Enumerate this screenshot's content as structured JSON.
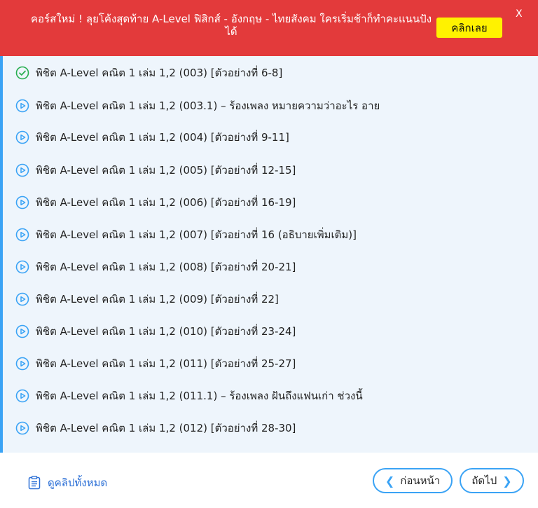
{
  "banner": {
    "text": "คอร์สใหม่ ! ลุยโค้งสุดท้าย A-Level ฟิสิกส์ - อังกฤษ - ไทยสังคม ใครเริ่มช้าก็ทำคะแนนปังได้",
    "cta_label": "คลิกเลย",
    "close_label": "X",
    "bg_color": "#e33a3b",
    "cta_color": "#fff200"
  },
  "lessons": [
    {
      "icon": "check-circle-icon",
      "title": "พิชิต A-Level คณิต 1 เล่ม 1,2 (003) [ตัวอย่างที่ 6-8]"
    },
    {
      "icon": "play-circle-icon",
      "title": "พิชิต A-Level คณิต 1 เล่ม 1,2 (003.1) – ร้องเพลง หมายความว่าอะไร อาย"
    },
    {
      "icon": "play-circle-icon",
      "title": "พิชิต A-Level คณิต 1 เล่ม 1,2 (004) [ตัวอย่างที่ 9-11]"
    },
    {
      "icon": "play-circle-icon",
      "title": "พิชิต A-Level คณิต 1 เล่ม 1,2 (005) [ตัวอย่างที่ 12-15]"
    },
    {
      "icon": "play-circle-icon",
      "title": "พิชิต A-Level คณิต 1 เล่ม 1,2 (006) [ตัวอย่างที่ 16-19]"
    },
    {
      "icon": "play-circle-icon",
      "title": "พิชิต A-Level คณิต 1 เล่ม 1,2 (007) [ตัวอย่างที่ 16 (อธิบายเพิ่มเติม)]"
    },
    {
      "icon": "play-circle-icon",
      "title": "พิชิต A-Level คณิต 1 เล่ม 1,2 (008) [ตัวอย่างที่ 20-21]"
    },
    {
      "icon": "play-circle-icon",
      "title": "พิชิต A-Level คณิต 1 เล่ม 1,2 (009) [ตัวอย่างที่ 22]"
    },
    {
      "icon": "play-circle-icon",
      "title": "พิชิต A-Level คณิต 1 เล่ม 1,2 (010) [ตัวอย่างที่ 23-24]"
    },
    {
      "icon": "play-circle-icon",
      "title": "พิชิต A-Level คณิต 1 เล่ม 1,2 (011) [ตัวอย่างที่ 25-27]"
    },
    {
      "icon": "play-circle-icon",
      "title": "พิชิต A-Level คณิต 1 เล่ม 1,2 (011.1) – ร้องเพลง ฝันถึงแฟนเก่า ช่วงนี้"
    },
    {
      "icon": "play-circle-icon",
      "title": "พิชิต A-Level คณิต 1 เล่ม 1,2 (012) [ตัวอย่างที่ 28-30]"
    }
  ],
  "footer": {
    "all_clips_label": "ดูคลิปทั้งหมด",
    "all_clips_icon": "clipboard-list-icon",
    "prev_label": "ก่อนหน้า",
    "next_label": "ถัดไป",
    "accent_color": "#3aa3f5"
  }
}
